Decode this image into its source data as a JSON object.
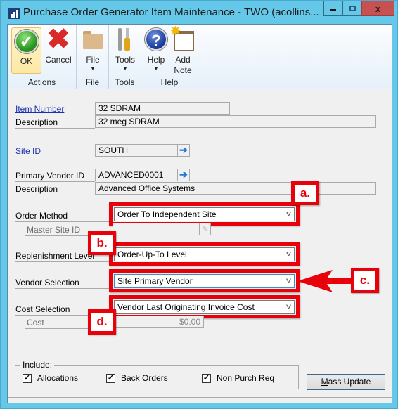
{
  "window": {
    "title": "Purchase Order Generator Item Maintenance  -  TWO (acollins...",
    "minimize_glyph": "minimize",
    "maximize_glyph": "maximize",
    "close_label": "x"
  },
  "ribbon": {
    "groups": [
      {
        "label": "Actions",
        "buttons": [
          {
            "label": "OK",
            "icon": "ok-check-icon"
          },
          {
            "label": "Cancel",
            "icon": "cancel-x-icon"
          }
        ]
      },
      {
        "label": "File",
        "buttons": [
          {
            "label": "File",
            "icon": "folder-icon",
            "dropdown": true
          }
        ]
      },
      {
        "label": "Tools",
        "buttons": [
          {
            "label": "Tools",
            "icon": "tools-icon",
            "dropdown": true
          }
        ]
      },
      {
        "label": "Help",
        "buttons": [
          {
            "label": "Help",
            "icon": "help-icon",
            "dropdown": true
          },
          {
            "label_line1": "Add",
            "label_line2": "Note",
            "icon": "add-note-icon"
          }
        ]
      }
    ],
    "ok_check": "✓",
    "cancel_x": "✖",
    "help_q": "?",
    "note_star": "✸",
    "caret": "▼"
  },
  "form": {
    "item_number": {
      "label": "Item Number",
      "value": "32 SDRAM"
    },
    "item_description": {
      "label": "Description",
      "value": "32 meg SDRAM"
    },
    "site_id": {
      "label": "Site ID",
      "value": "SOUTH"
    },
    "primary_vendor_id": {
      "label": "Primary Vendor ID",
      "value": "ADVANCED0001"
    },
    "vendor_description": {
      "label": "Description",
      "value": "Advanced Office Systems"
    },
    "order_method": {
      "label": "Order Method",
      "value": "Order To Independent Site"
    },
    "master_site_id": {
      "label": "Master Site ID",
      "value": ""
    },
    "replenishment_level": {
      "label": "Replenishment Level",
      "value": "Order-Up-To Level"
    },
    "vendor_selection": {
      "label": "Vendor Selection",
      "value": "Site Primary Vendor"
    },
    "cost_selection": {
      "label": "Cost Selection",
      "value": "Vendor Last Originating Invoice Cost"
    },
    "cost": {
      "label": "Cost",
      "value": "$0.00"
    },
    "include": {
      "title": "Include:",
      "options": [
        {
          "label": "Allocations",
          "checked": true
        },
        {
          "label": "Back Orders",
          "checked": true
        },
        {
          "label": "Non Purch Req",
          "checked": true
        }
      ]
    },
    "mass_update": {
      "accel": "M",
      "rest": "ass Update"
    },
    "lookup_arrow": "➔",
    "chevron": "v",
    "check_mark": "✓",
    "pencil": "✎"
  },
  "callouts": {
    "a": "a.",
    "b": "b.",
    "c": "c.",
    "d": "d.",
    "color": "#e8000a"
  }
}
